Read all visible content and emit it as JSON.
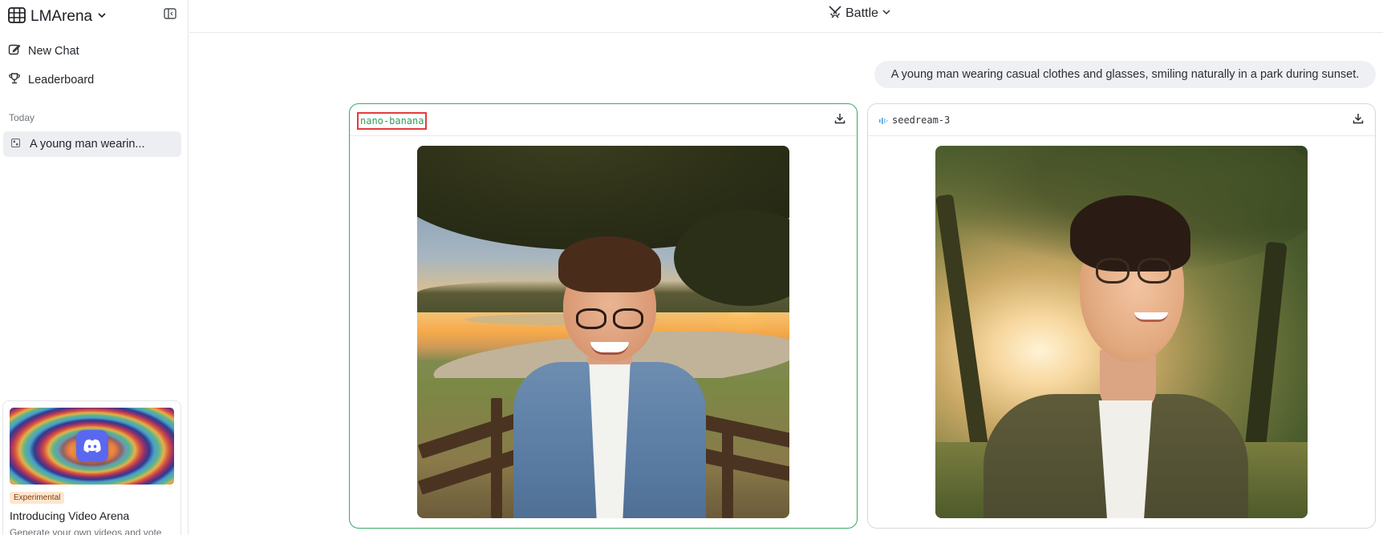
{
  "sidebar": {
    "brand": "LMArena",
    "new_chat": "New Chat",
    "leaderboard": "Leaderboard",
    "section_today": "Today",
    "chats": [
      {
        "title": "A young man wearin..."
      }
    ],
    "promo": {
      "badge": "Experimental",
      "title": "Introducing Video Arena",
      "description": "Generate your own videos and vote"
    }
  },
  "header": {
    "mode": "Battle"
  },
  "conversation": {
    "prompt": "A young man wearing casual clothes and glasses, smiling naturally in a park during sunset.",
    "responses": [
      {
        "model": "nano-banana",
        "status": "selected"
      },
      {
        "model": "seedream-3",
        "status": ""
      }
    ]
  },
  "colors": {
    "winner_border": "#3aa866",
    "winner_label": "#2f9e5c",
    "highlight_box": "#e23c3c",
    "sidebar_active": "#eceef2",
    "prompt_bubble": "#eef0f4",
    "promo_badge_bg": "#fde6cf"
  },
  "icons": {
    "brand": "grid-table-icon",
    "collapse": "sidebar-collapse-icon",
    "new_chat": "edit-icon",
    "leaderboard": "trophy-icon",
    "chat_item": "image-icon",
    "mode": "crossed-swords-icon",
    "download": "download-icon",
    "audio": "audio-wave-icon"
  }
}
